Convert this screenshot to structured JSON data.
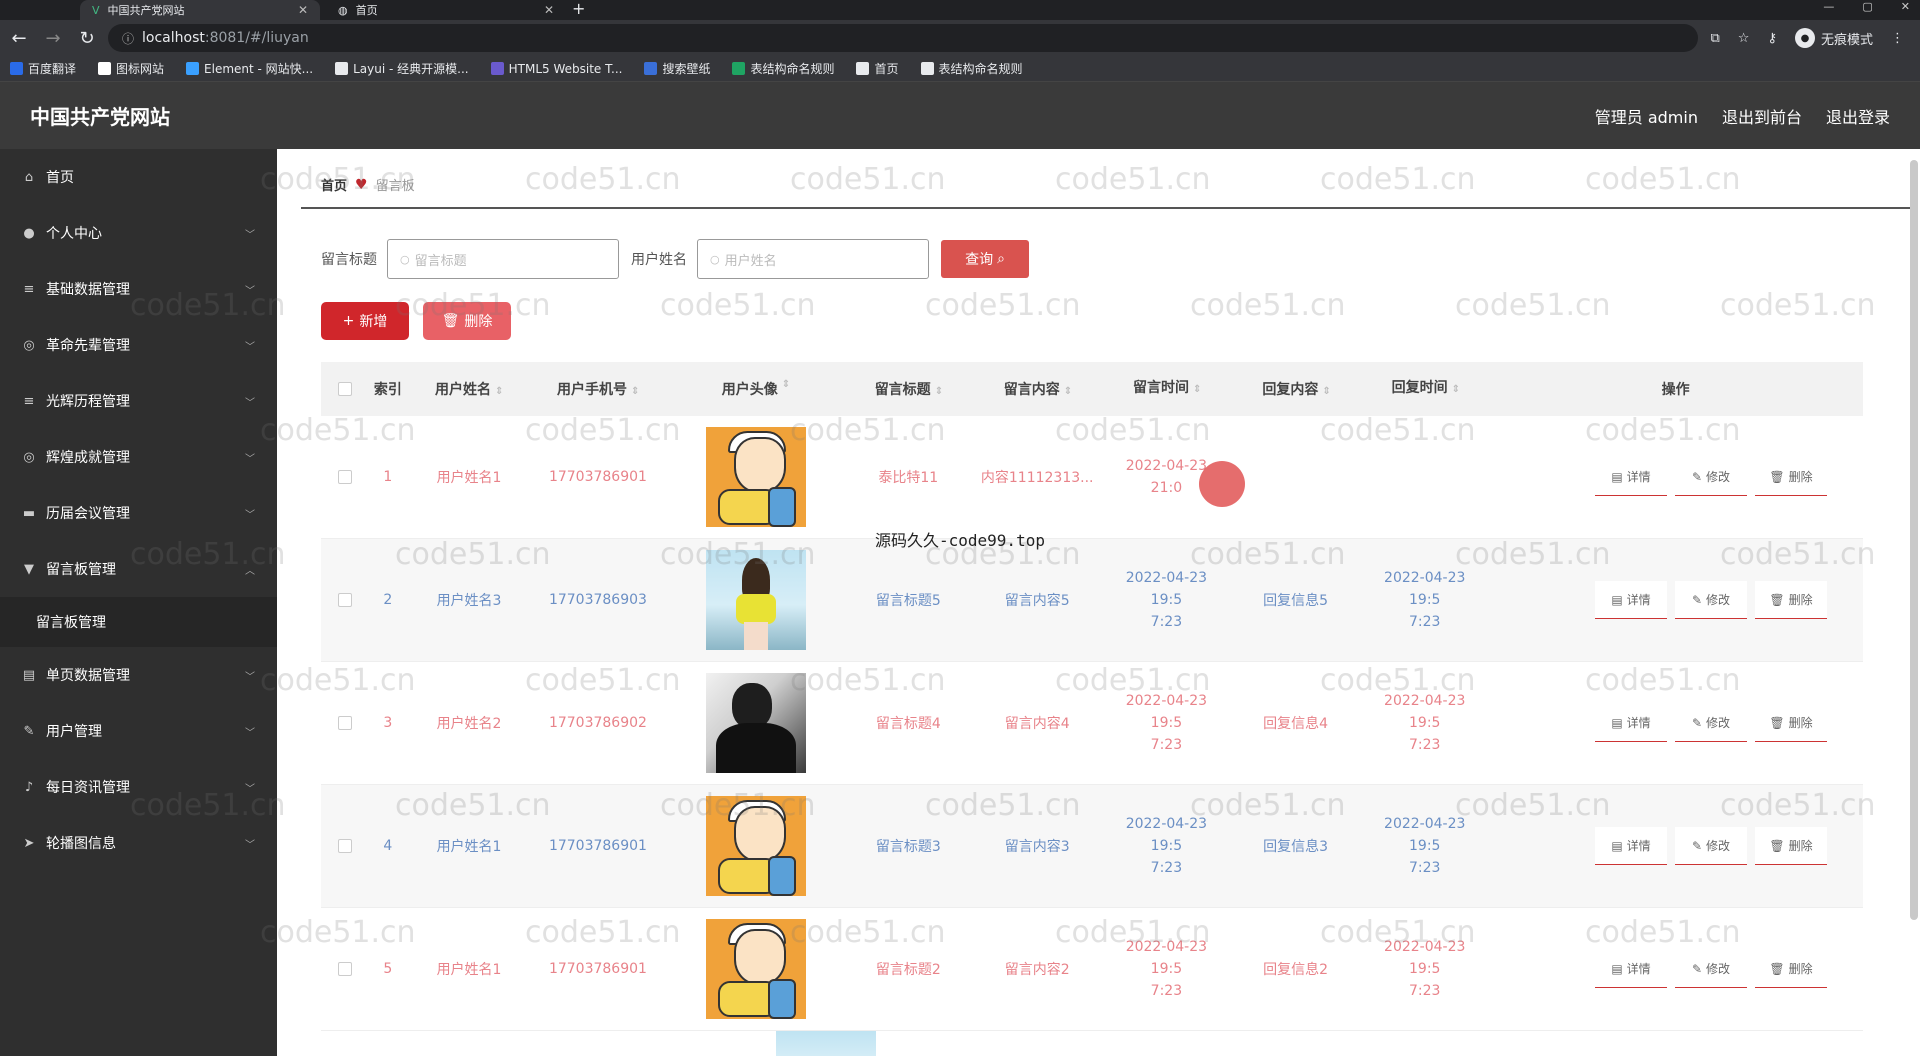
{
  "browser": {
    "tabs": [
      {
        "label": "中国共产党网站",
        "active": true
      },
      {
        "label": "首页",
        "active": false
      }
    ],
    "url_host": "localhost",
    "url_rest": ":8081/#/liuyan",
    "profile_label": "无痕模式",
    "bookmarks": [
      {
        "label": "百度翻译",
        "color": "#2a6be8"
      },
      {
        "label": "图标网站",
        "color": "#ffffff"
      },
      {
        "label": "Element - 网站快...",
        "color": "#3aa0ff"
      },
      {
        "label": "Layui - 经典开源模...",
        "color": "#e8eaed"
      },
      {
        "label": "HTML5 Website T...",
        "color": "#6a5acd"
      },
      {
        "label": "搜索壁纸",
        "color": "#3a6fd8"
      },
      {
        "label": "表结构命名规则",
        "color": "#1fa463"
      },
      {
        "label": "首页",
        "color": "#e8eaed"
      },
      {
        "label": "表结构命名规则",
        "color": "#e8eaed"
      }
    ]
  },
  "header": {
    "site_title": "中国共产党网站",
    "admin_label": "管理员 admin",
    "to_front": "退出到前台",
    "logout": "退出登录"
  },
  "sidebar": {
    "items": [
      {
        "label": "首页",
        "icon": "home-icon",
        "glyph": "⌂"
      },
      {
        "label": "个人中心",
        "icon": "user-icon",
        "glyph": "●"
      },
      {
        "label": "基础数据管理",
        "icon": "menu-icon",
        "glyph": "≡"
      },
      {
        "label": "革命先辈管理",
        "icon": "compass-icon",
        "glyph": "◎"
      },
      {
        "label": "光辉历程管理",
        "icon": "menu-icon",
        "glyph": "≡"
      },
      {
        "label": "辉煌成就管理",
        "icon": "compass-icon",
        "glyph": "◎"
      },
      {
        "label": "历届会议管理",
        "icon": "bank-icon",
        "glyph": "▬"
      },
      {
        "label": "留言板管理",
        "icon": "chat-icon",
        "glyph": "▼"
      },
      {
        "label": "单页数据管理",
        "icon": "doc-icon",
        "glyph": "▤"
      },
      {
        "label": "用户管理",
        "icon": "edit-icon",
        "glyph": "✎"
      },
      {
        "label": "每日资讯管理",
        "icon": "mic-icon",
        "glyph": "♪"
      },
      {
        "label": "轮播图信息",
        "icon": "send-icon",
        "glyph": "➤"
      }
    ],
    "sub_item": "留言板管理"
  },
  "breadcrumb": {
    "home": "首页",
    "current": "留言板"
  },
  "search": {
    "title_label": "留言标题",
    "title_placeholder": "留言标题",
    "name_label": "用户姓名",
    "name_placeholder": "用户姓名",
    "query_button": "查询"
  },
  "actions": {
    "add": "新增",
    "delete": "删除"
  },
  "table": {
    "headers": {
      "index": "索引",
      "name": "用户姓名",
      "phone": "用户手机号",
      "avatar": "用户头像",
      "title": "留言标题",
      "content": "留言内容",
      "time": "留言时间",
      "reply": "回复内容",
      "reply_time": "回复时间",
      "ops": "操作"
    },
    "op_labels": {
      "detail": "详情",
      "edit": "修改",
      "delete": "删除"
    },
    "rows": [
      {
        "index": "1",
        "name": "用户姓名1",
        "phone": "17703786901",
        "avatar": "cartoon",
        "title": "泰比特11",
        "content": "内容11112313...",
        "time": "2022-04-23 21:0",
        "time2": "",
        "reply": "",
        "reply_time": "",
        "reply_time2": ""
      },
      {
        "index": "2",
        "name": "用户姓名3",
        "phone": "17703786903",
        "avatar": "girl",
        "title": "留言标题5",
        "content": "留言内容5",
        "time": "2022-04-23 19:5",
        "time2": "7:23",
        "reply": "回复信息5",
        "reply_time": "2022-04-23 19:5",
        "reply_time2": "7:23"
      },
      {
        "index": "3",
        "name": "用户姓名2",
        "phone": "17703786902",
        "avatar": "dark",
        "title": "留言标题4",
        "content": "留言内容4",
        "time": "2022-04-23 19:5",
        "time2": "7:23",
        "reply": "回复信息4",
        "reply_time": "2022-04-23 19:5",
        "reply_time2": "7:23"
      },
      {
        "index": "4",
        "name": "用户姓名1",
        "phone": "17703786901",
        "avatar": "cartoon",
        "title": "留言标题3",
        "content": "留言内容3",
        "time": "2022-04-23 19:5",
        "time2": "7:23",
        "reply": "回复信息3",
        "reply_time": "2022-04-23 19:5",
        "reply_time2": "7:23"
      },
      {
        "index": "5",
        "name": "用户姓名1",
        "phone": "17703786901",
        "avatar": "cartoon",
        "title": "留言标题2",
        "content": "留言内容2",
        "time": "2022-04-23 19:5",
        "time2": "7:23",
        "reply": "回复信息2",
        "reply_time": "2022-04-23 19:5",
        "reply_time2": "7:23"
      }
    ]
  },
  "overlay": {
    "watermark_text": "code51.cn",
    "center_text": "源码久久-code99.top"
  },
  "colors": {
    "accent_red": "#d0262b",
    "odd_row_text": "#e8838a",
    "even_row_text": "#6b8fc4",
    "sidebar_bg": "#2f2f2f",
    "header_bg": "#3a3a3a"
  }
}
